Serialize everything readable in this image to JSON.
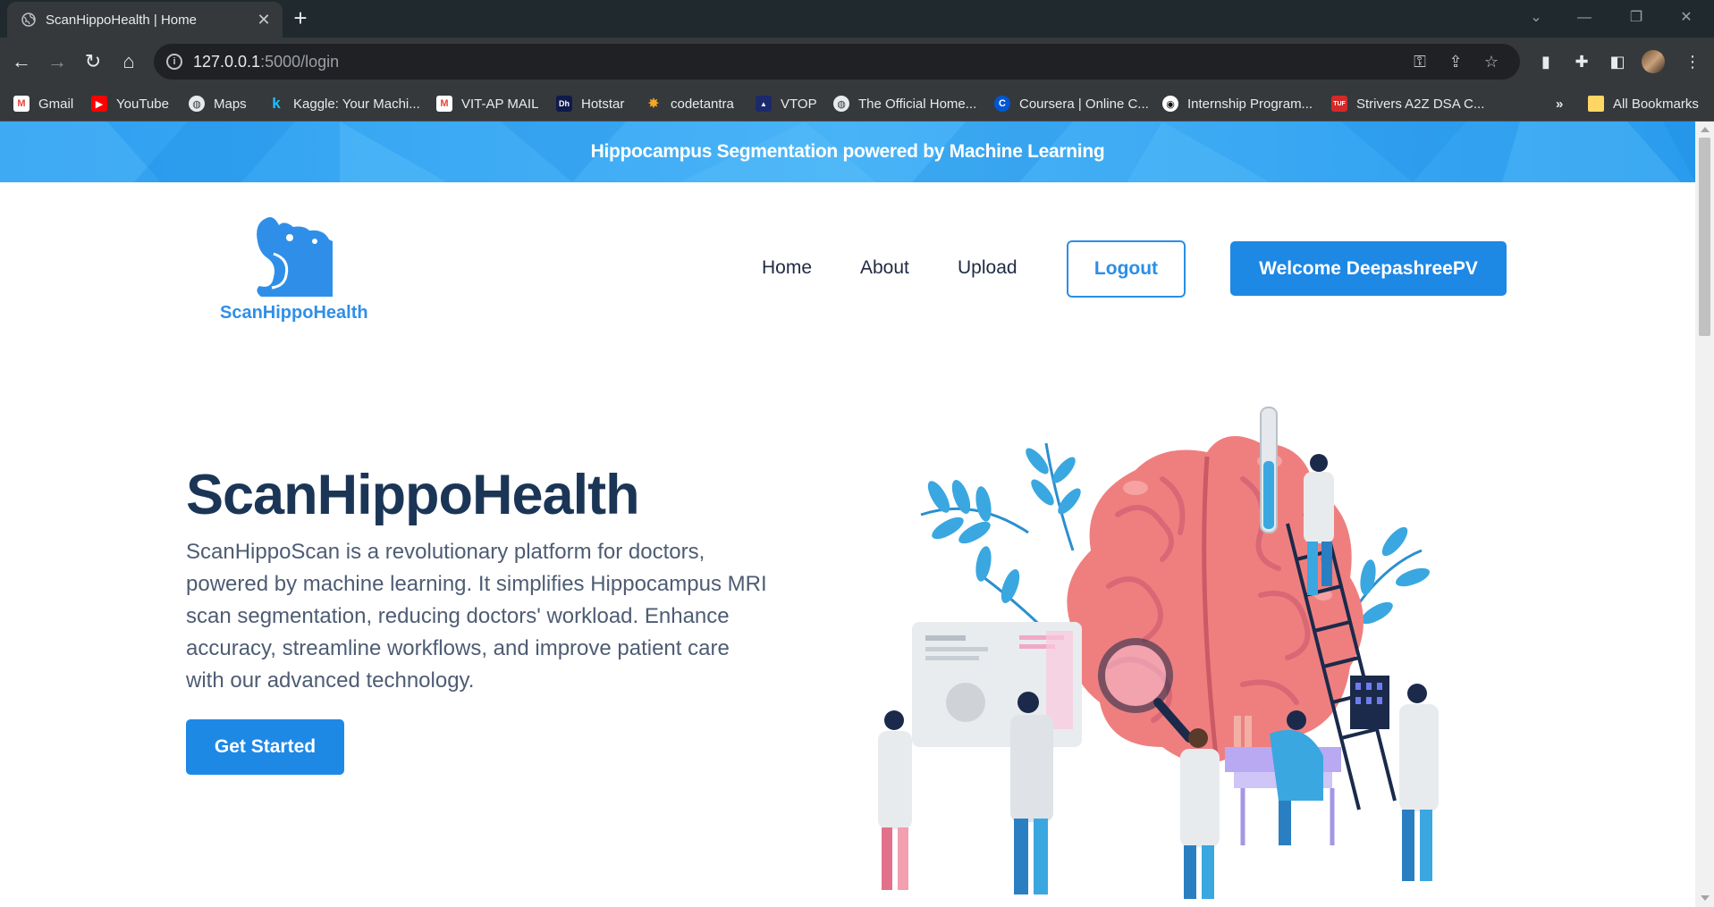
{
  "browser": {
    "tab_title": "ScanHippoHealth | Home",
    "url_host": "127.0.0.1",
    "url_rest": ":5000/login",
    "bookmarks": [
      {
        "label": "Gmail",
        "icon": "gmail-icon",
        "color": "#ea4335"
      },
      {
        "label": "YouTube",
        "icon": "youtube-icon",
        "color": "#ff0000"
      },
      {
        "label": "Maps",
        "icon": "globe-icon",
        "color": "#e8eaed"
      },
      {
        "label": "Kaggle: Your Machi...",
        "icon": "kaggle-icon",
        "color": "#20beff"
      },
      {
        "label": "VIT-AP MAIL",
        "icon": "gmail-icon",
        "color": "#ea4335"
      },
      {
        "label": "Hotstar",
        "icon": "hotstar-icon",
        "color": "#0f1a4a"
      },
      {
        "label": "codetantra",
        "icon": "sun-icon",
        "color": "#f5a623"
      },
      {
        "label": "VTOP",
        "icon": "vtop-icon",
        "color": "#1a2a6c"
      },
      {
        "label": "The Official Home...",
        "icon": "globe-icon",
        "color": "#e8eaed"
      },
      {
        "label": "Coursera | Online C...",
        "icon": "coursera-icon",
        "color": "#0056d2"
      },
      {
        "label": "Internship Program...",
        "icon": "target-icon",
        "color": "#ffffff"
      },
      {
        "label": "Strivers A2Z DSA C...",
        "icon": "tuf-icon",
        "color": "#d62828"
      }
    ],
    "all_bookmarks_label": "All Bookmarks",
    "overflow_label": "»"
  },
  "banner": {
    "text": "Hippocampus Segmentation powered by Machine Learning"
  },
  "header": {
    "logo_text": "ScanHippoHealth",
    "nav": [
      "Home",
      "About",
      "Upload"
    ],
    "logout_label": "Logout",
    "welcome_label": "Welcome DeepashreePV"
  },
  "hero": {
    "title": "ScanHippoHealth",
    "description": "ScanHippoScan is a revolutionary platform for doctors, powered by machine learning. It simplifies Hippocampus MRI scan segmentation, reducing doctors' workload. Enhance accuracy, streamline workflows, and improve patient care with our advanced technology.",
    "cta_label": "Get Started"
  },
  "colors": {
    "brand_blue": "#1e88e5",
    "banner_blue": "#3aa8f3",
    "heading_navy": "#1b3556"
  }
}
